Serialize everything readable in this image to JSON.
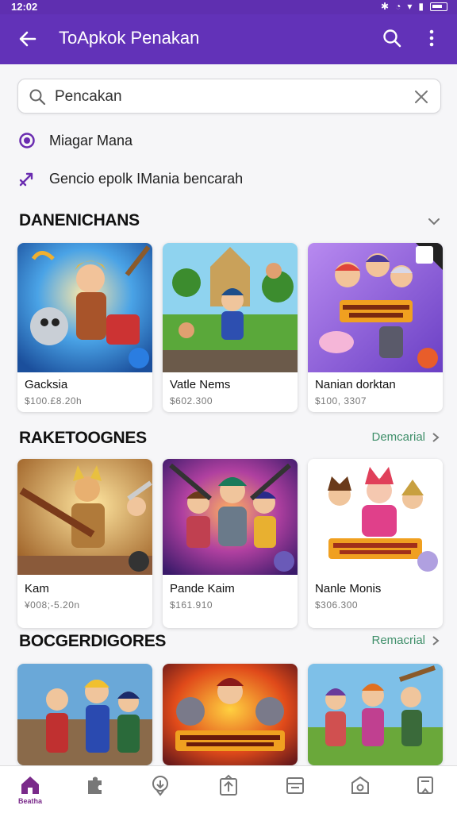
{
  "status": {
    "time": "12:02"
  },
  "app_bar": {
    "title": "ToApkok Penakan"
  },
  "search": {
    "value": "Pencakan",
    "placeholder": "Pencakan"
  },
  "suggestions": [
    {
      "label": "Miagar Mana",
      "icon": "radio-circle-icon"
    },
    {
      "label": "Gencio epolk IMania bencarah",
      "icon": "tag-arrow-icon"
    }
  ],
  "sections": [
    {
      "title": "DANENICHANS",
      "action": "",
      "cards": [
        {
          "name": "Gacksia",
          "price": "$100.£8.20h",
          "art": "warrior"
        },
        {
          "name": "Vatle Nems",
          "price": "$602.300",
          "art": "adventure"
        },
        {
          "name": "Nanian dorktan",
          "price": "$100, 3307",
          "art": "mania"
        }
      ]
    },
    {
      "title": "RAKETOOGNES",
      "action": "Demcarial",
      "cards": [
        {
          "name": "Kam",
          "price": "¥008;-5.20n",
          "art": "guitar"
        },
        {
          "name": "Pande Kaim",
          "price": "$161.910",
          "art": "heroes"
        },
        {
          "name": "Nanle Monis",
          "price": "$306.300",
          "art": "cats"
        }
      ]
    },
    {
      "title": "BOCGERDIGORES",
      "action": "Remacrial",
      "cards": [
        {
          "name": "",
          "price": "",
          "art": "squad"
        },
        {
          "name": "",
          "price": "",
          "art": "monsters"
        },
        {
          "name": "",
          "price": "",
          "art": "party"
        }
      ]
    }
  ],
  "bottom_nav": {
    "items": [
      {
        "label": "Beatha",
        "icon": "home-icon",
        "active": true
      },
      {
        "label": "",
        "icon": "puzzle-icon"
      },
      {
        "label": "",
        "icon": "location-icon"
      },
      {
        "label": "",
        "icon": "upload-box-icon"
      },
      {
        "label": "",
        "icon": "wallet-icon"
      },
      {
        "label": "",
        "icon": "camera-icon"
      },
      {
        "label": "",
        "icon": "bookmark-icon"
      }
    ]
  },
  "colors": {
    "primary": "#6232b8",
    "accent_green": "#3f8f6a",
    "nav_active": "#7a2a8a"
  }
}
